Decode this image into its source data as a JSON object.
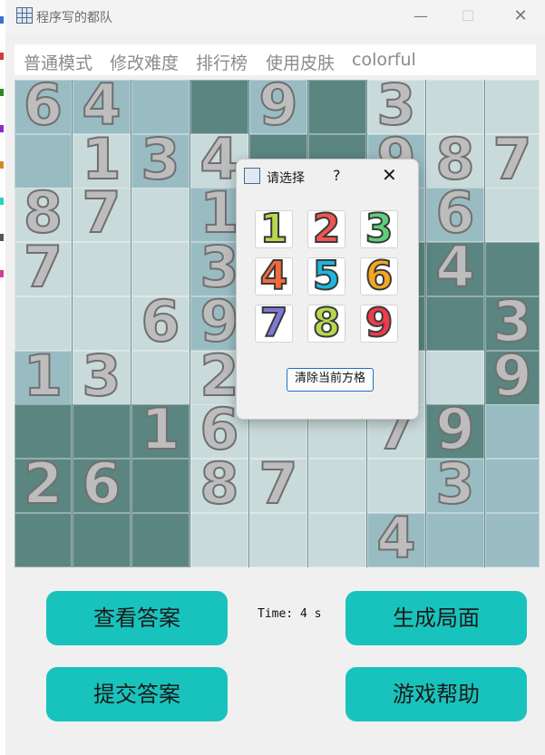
{
  "window": {
    "title": "程序写的都队",
    "minimize": "—",
    "maximize": "☐",
    "close": "✕"
  },
  "menu": [
    "普通模式",
    "修改难度",
    "排行榜",
    "使用皮肤",
    "colorful"
  ],
  "board": {
    "colors": {
      "light": "#c9dadb",
      "mid": "#99bcc3",
      "dark": "#5b8580"
    },
    "shades": [
      [
        "m",
        "m",
        "m",
        "d",
        "m",
        "d",
        "l",
        "l",
        "l"
      ],
      [
        "m",
        "l",
        "m",
        "l",
        "d",
        "d",
        "m",
        "l",
        "l"
      ],
      [
        "l",
        "l",
        "l",
        "m",
        "d",
        "d",
        "m",
        "m",
        "l"
      ],
      [
        "l",
        "l",
        "l",
        "m",
        "d",
        "d",
        "d",
        "d",
        "d"
      ],
      [
        "l",
        "l",
        "l",
        "m",
        "d",
        "d",
        "d",
        "d",
        "d"
      ],
      [
        "m",
        "l",
        "l",
        "l",
        "d",
        "d",
        "l",
        "l",
        "d"
      ],
      [
        "d",
        "d",
        "d",
        "l",
        "l",
        "l",
        "l",
        "d",
        "m"
      ],
      [
        "d",
        "d",
        "d",
        "l",
        "l",
        "l",
        "l",
        "m",
        "m"
      ],
      [
        "d",
        "d",
        "d",
        "l",
        "l",
        "l",
        "m",
        "m",
        "m"
      ]
    ],
    "cells": [
      [
        "6",
        "4",
        "",
        "",
        "9",
        "",
        "3",
        "",
        ""
      ],
      [
        "",
        "1",
        "3",
        "4",
        "",
        "",
        "9",
        "8",
        "7"
      ],
      [
        "8",
        "7",
        "",
        "1",
        "",
        "",
        "",
        "6",
        ""
      ],
      [
        "7",
        "",
        "",
        "3",
        "",
        "",
        "",
        "4",
        ""
      ],
      [
        "",
        "",
        "6",
        "9",
        "",
        "",
        "",
        "",
        "3"
      ],
      [
        "1",
        "3",
        "",
        "2",
        "",
        "",
        "",
        "",
        "9"
      ],
      [
        "",
        "",
        "1",
        "6",
        "",
        "",
        "7",
        "9",
        ""
      ],
      [
        "2",
        "6",
        "",
        "8",
        "7",
        "",
        "",
        "3",
        ""
      ],
      [
        "",
        "",
        "",
        "",
        "",
        "",
        "4",
        "",
        ""
      ]
    ]
  },
  "dialog": {
    "title": "请选择",
    "help": "?",
    "close": "✕",
    "numbers": [
      "1",
      "2",
      "3",
      "4",
      "5",
      "6",
      "7",
      "8",
      "9"
    ],
    "number_colors": [
      "#b7d94f",
      "#f2554f",
      "#5fd07a",
      "#f26a3c",
      "#1ab8e0",
      "#f5a623",
      "#7b7bd6",
      "#b7d94f",
      "#ef3b4b"
    ],
    "clear_button": "清除当前方格"
  },
  "buttons": {
    "view_answer": "查看答案",
    "generate": "生成局面",
    "submit": "提交答案",
    "help": "游戏帮助"
  },
  "timer": "Time: 4 s",
  "edge_marks": [
    {
      "color": "#3b6fd1"
    },
    {
      "color": "#d23b3b"
    },
    {
      "color": "#2a8a2a"
    },
    {
      "color": "#8a2ad2"
    },
    {
      "color": "#d28a2a"
    },
    {
      "color": "#2ad2c3"
    },
    {
      "color": "#555555"
    },
    {
      "color": "#d23b9a"
    }
  ]
}
